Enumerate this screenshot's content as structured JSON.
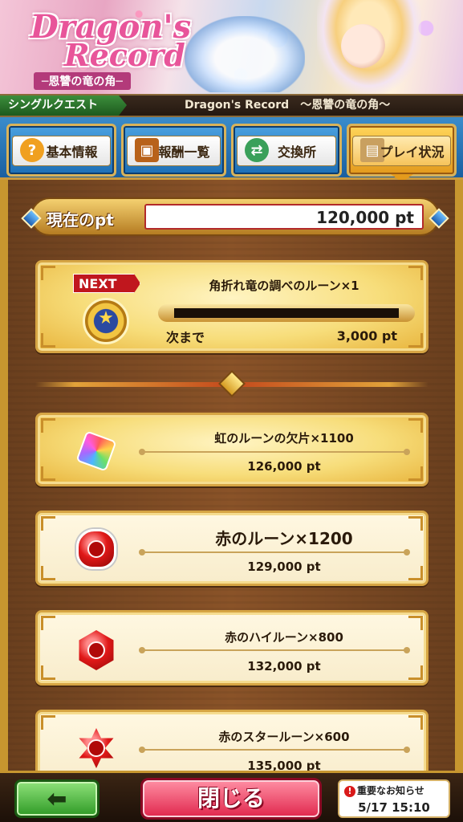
{
  "banner": {
    "logo_line1": "Dragon's",
    "logo_line2": "Record",
    "logo_subtitle": "─恩讐の竜の角─"
  },
  "questbar": {
    "tag": "シングルクエスト",
    "title": "Dragon's Record　～恩讐の竜の角～"
  },
  "tabs": [
    {
      "label": "基本情報",
      "icon": "question-icon",
      "active": false
    },
    {
      "label": "報酬一覧",
      "icon": "treasure-chest-icon",
      "active": false
    },
    {
      "label": "交換所",
      "icon": "exchange-icon",
      "active": false
    },
    {
      "label": "プレイ状況",
      "icon": "scroll-icon",
      "active": true
    }
  ],
  "current_pt": {
    "label": "現在のpt",
    "value": "120,000 pt"
  },
  "next_reward": {
    "badge": "NEXT",
    "name": "角折れ竜の調べのルーン×1",
    "remaining_label": "次まで",
    "remaining_value": "3,000 pt",
    "progress": 0.0
  },
  "rewards": [
    {
      "name": "虹のルーンの欠片×1100",
      "points": "126,000 pt",
      "icon": "rainbow-rune-fragment-icon"
    },
    {
      "name": "赤のルーン×1200",
      "points": "129,000 pt",
      "icon": "red-rune-icon"
    },
    {
      "name": "赤のハイルーン×800",
      "points": "132,000 pt",
      "icon": "red-high-rune-icon"
    },
    {
      "name": "赤のスタールーン×600",
      "points": "135,000 pt",
      "icon": "red-star-rune-icon"
    }
  ],
  "bottom": {
    "back_icon": "back-arrow-icon",
    "close_label": "閉じる",
    "notice_title": "重要なお知らせ",
    "notice_datetime": "5/17 15:10"
  },
  "colors": {
    "close_button": "#e0264c",
    "back_button": "#2f9a26",
    "tab_blue": "#1d6fb6",
    "tab_active": "#e39a1c",
    "panel_brown": "#8a5328"
  }
}
